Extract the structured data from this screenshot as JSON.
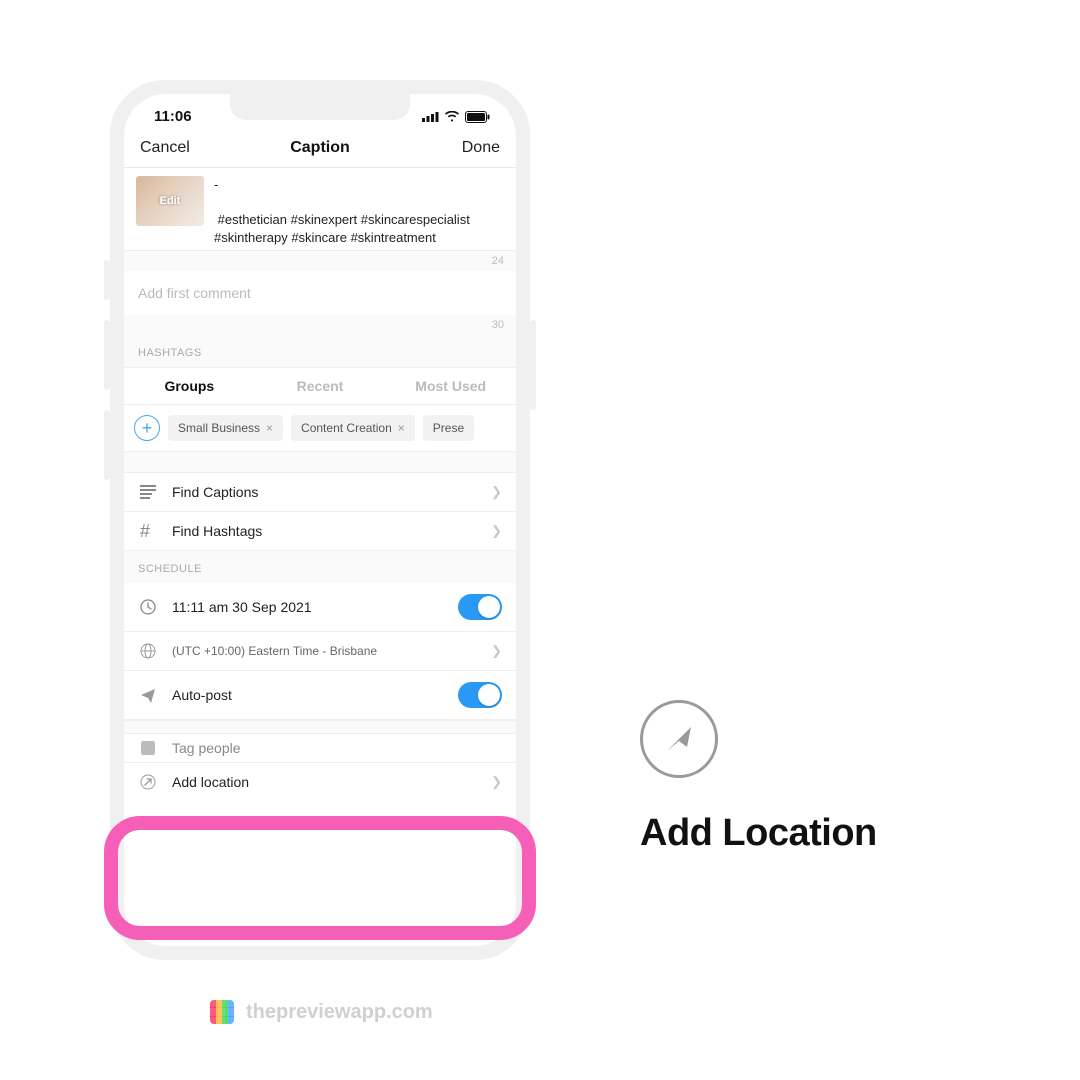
{
  "status": {
    "time": "11:06"
  },
  "nav": {
    "cancel": "Cancel",
    "title": "Caption",
    "done": "Done"
  },
  "caption": {
    "thumb_label": "Edit",
    "text": "-\n\n #esthetician #skinexpert #skincarespecialist #skintherapy #skincare #skintreatment",
    "count": "24"
  },
  "first_comment": {
    "placeholder": "Add first comment",
    "count": "30"
  },
  "hashtags": {
    "section": "HASHTAGS",
    "tabs": {
      "groups": "Groups",
      "recent": "Recent",
      "most_used": "Most Used"
    },
    "chips": [
      {
        "label": "Small Business"
      },
      {
        "label": "Content Creation"
      },
      {
        "label": "Prese"
      }
    ]
  },
  "tools": {
    "find_captions": "Find Captions",
    "find_hashtags": "Find Hashtags"
  },
  "schedule": {
    "section": "SCHEDULE",
    "datetime": "11:11 am  30 Sep 2021",
    "timezone": "(UTC +10:00) Eastern Time - Brisbane",
    "autopost": "Auto-post",
    "tag_people": "Tag people",
    "add_location": "Add location"
  },
  "callout": {
    "title": "Add Location"
  },
  "watermark": {
    "text": "thepreviewapp.com"
  }
}
